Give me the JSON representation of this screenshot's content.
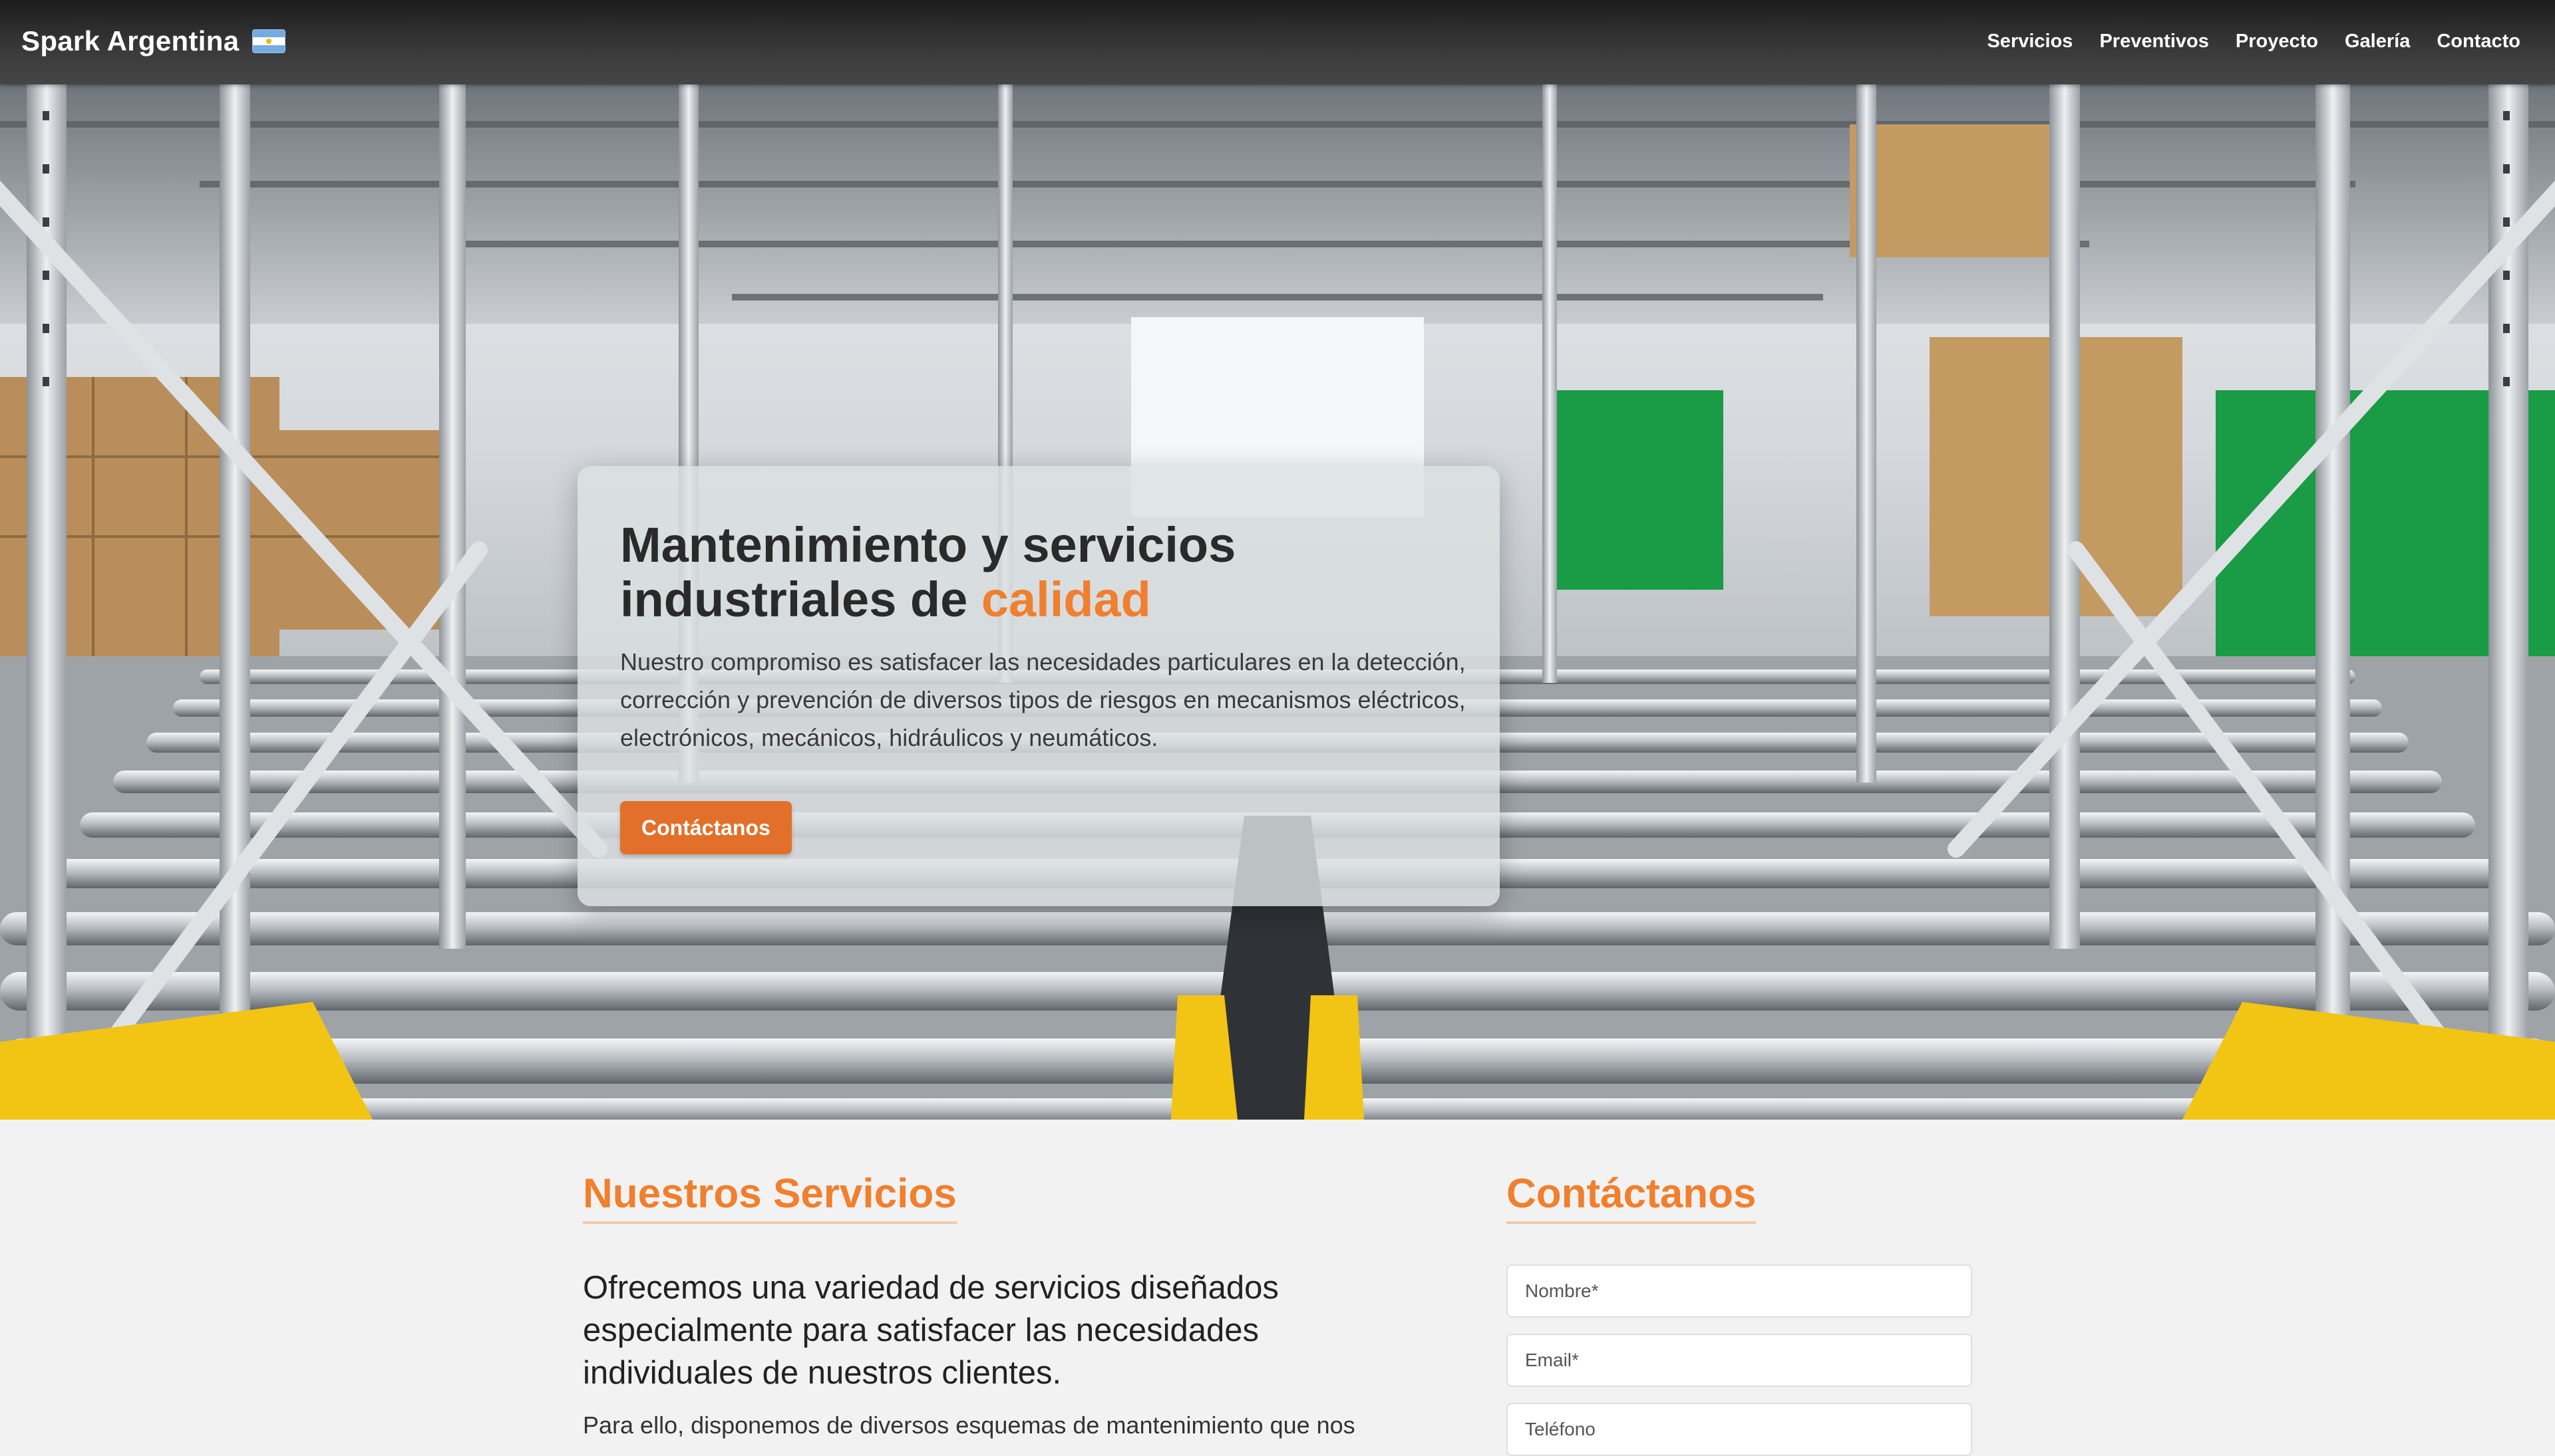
{
  "brand": {
    "name": "Spark Argentina",
    "flag_icon": "argentina-flag-icon"
  },
  "nav": {
    "items": [
      {
        "label": "Servicios"
      },
      {
        "label": "Preventivos"
      },
      {
        "label": "Proyecto"
      },
      {
        "label": "Galería"
      },
      {
        "label": "Contacto"
      }
    ]
  },
  "hero": {
    "title_part1": "Mantenimiento y servicios industriales de ",
    "title_accent": "calidad",
    "description": "Nuestro compromiso es satisfacer las necesidades particulares en la detección, corrección y prevención de diversos tipos de riesgos en mecanismos eléctricos, electrónicos, mecánicos, hidráulicos y neumáticos.",
    "cta_label": "Contáctanos",
    "background": "warehouse-conveyor-rollers-image"
  },
  "services": {
    "title": "Nuestros Servicios",
    "lead": "Ofrecemos una variedad de servicios diseñados especialmente para satisfacer las necesidades individuales de nuestros clientes.",
    "body": "Para ello, disponemos de diversos esquemas de mantenimiento que nos"
  },
  "contact": {
    "title": "Contáctanos",
    "name_placeholder": "Nombre*",
    "email_placeholder": "Email*",
    "phone_placeholder": "Teléfono"
  },
  "colors": {
    "accent": "#f07f2e",
    "button": "#e2702a",
    "nav_bg": "#2e2e2e",
    "page_bg": "#f2f2f2"
  }
}
